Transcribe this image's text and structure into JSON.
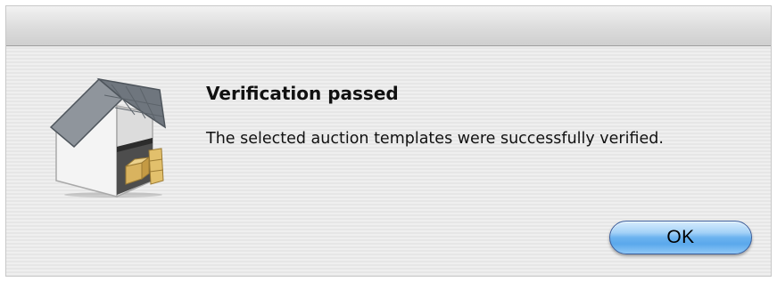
{
  "dialog": {
    "title": "Verification passed",
    "message": "The selected auction templates were successfully verified.",
    "icon": "warehouse-app-icon",
    "ok_label": "OK"
  },
  "colors": {
    "button_blue": "#5aa8ec",
    "background": "#ececec"
  }
}
